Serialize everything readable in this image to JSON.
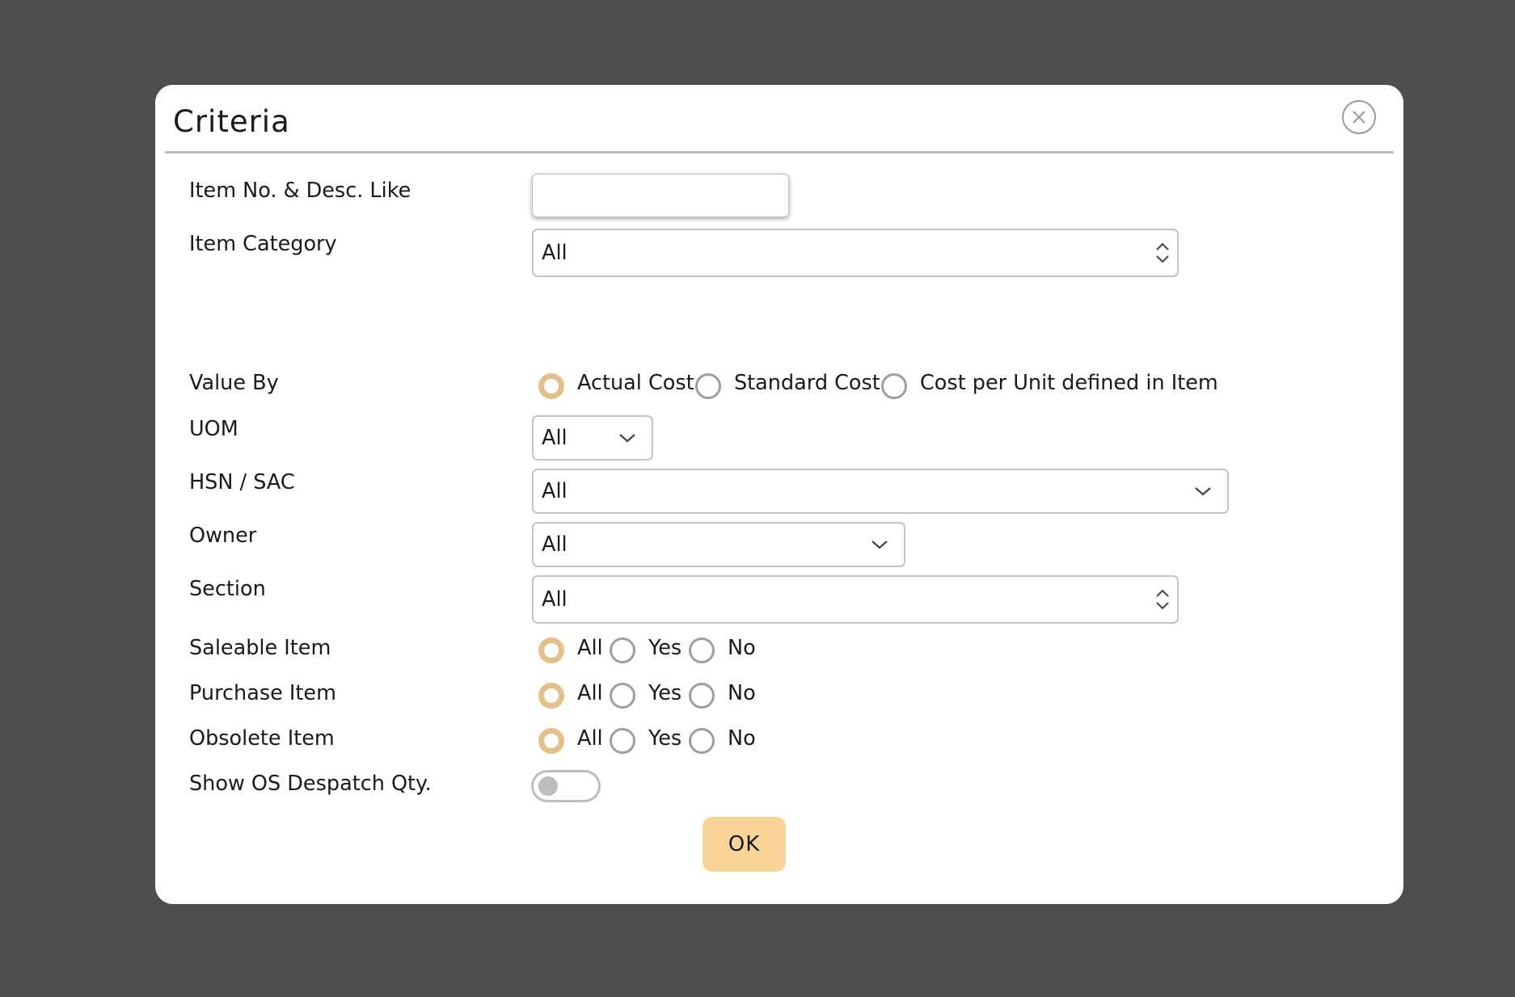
{
  "dialog": {
    "title": "Criteria",
    "close_icon": "close-circle-icon",
    "ok_label": "OK"
  },
  "colors": {
    "overlay": "#4d4d4d",
    "accent_radio": "#e3c08a",
    "ok_button": "#f8d498"
  },
  "fields": {
    "item_no": {
      "label": "Item No. & Desc. Like",
      "value": "",
      "placeholder": ""
    },
    "item_category": {
      "label": "Item Category",
      "value": "All",
      "icon": "up-down-chevron-icon"
    },
    "value_by": {
      "label": "Value By",
      "options": [
        "Actual Cost",
        "Standard Cost",
        "Cost per Unit defined in Item"
      ],
      "selected": "Actual Cost"
    },
    "uom": {
      "label": "UOM",
      "value": "All",
      "icon": "chevron-down-icon"
    },
    "hsn_sac": {
      "label": "HSN / SAC",
      "value": "All",
      "icon": "chevron-down-icon"
    },
    "owner": {
      "label": "Owner",
      "value": "All",
      "icon": "chevron-down-icon"
    },
    "section": {
      "label": "Section",
      "value": "All",
      "icon": "up-down-chevron-icon"
    },
    "saleable_item": {
      "label": "Saleable Item",
      "options": [
        "All",
        "Yes",
        "No"
      ],
      "selected": "All"
    },
    "purchase_item": {
      "label": "Purchase Item",
      "options": [
        "All",
        "Yes",
        "No"
      ],
      "selected": "All"
    },
    "obsolete_item": {
      "label": "Obsolete Item",
      "options": [
        "All",
        "Yes",
        "No"
      ],
      "selected": "All"
    },
    "show_os_despatch": {
      "label": "Show OS Despatch Qty.",
      "on": false
    }
  }
}
